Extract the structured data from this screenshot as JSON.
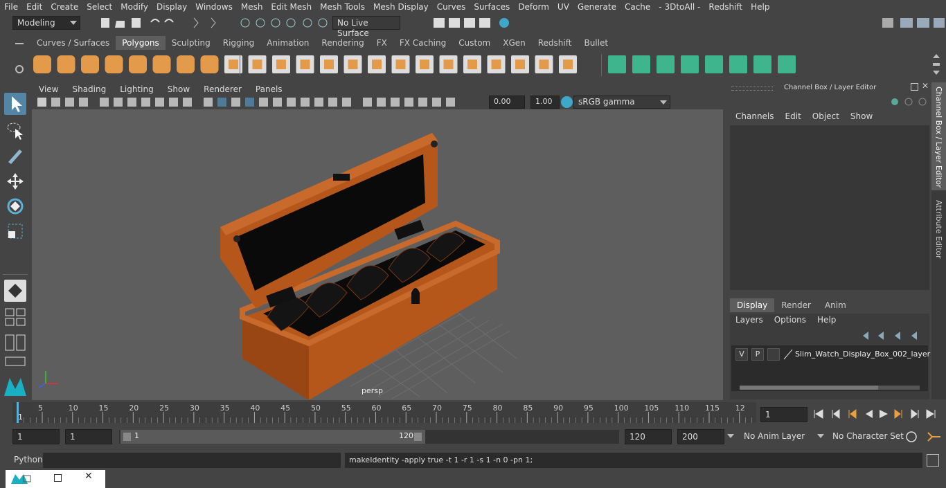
{
  "menubar": {
    "items": [
      "File",
      "Edit",
      "Create",
      "Select",
      "Modify",
      "Display",
      "Windows",
      "Mesh",
      "Edit Mesh",
      "Mesh Tools",
      "Mesh Display",
      "Curves",
      "Surfaces",
      "Deform",
      "UV",
      "Generate",
      "Cache",
      "- 3DtoAll -",
      "Redshift",
      "Help"
    ]
  },
  "statusline": {
    "mode": "Modeling",
    "live_surface": "No Live Surface"
  },
  "shelf": {
    "tabs": [
      "Curves / Surfaces",
      "Polygons",
      "Sculpting",
      "Rigging",
      "Animation",
      "Rendering",
      "FX",
      "FX Caching",
      "Custom",
      "XGen",
      "Redshift",
      "Bullet"
    ],
    "active_tab": "Polygons"
  },
  "panel": {
    "menus": [
      "View",
      "Shading",
      "Lighting",
      "Show",
      "Renderer",
      "Panels"
    ],
    "exposure": "0.00",
    "gamma": "1.00",
    "colorspace": "sRGB gamma",
    "camera_label": "persp"
  },
  "channelbox": {
    "title": "Channel Box / Layer Editor",
    "menus": [
      "Channels",
      "Edit",
      "Object",
      "Show"
    ],
    "layer_tabs": [
      "Display",
      "Render",
      "Anim"
    ],
    "active_layer_tab": "Display",
    "layer_menus": [
      "Layers",
      "Options",
      "Help"
    ],
    "layer": {
      "v": "V",
      "p": "P",
      "name": "Slim_Watch_Display_Box_002_layer"
    },
    "side_tabs": [
      "Channel Box / Layer Editor",
      "Attribute Editor"
    ]
  },
  "timeline": {
    "ticks": [
      "5",
      "10",
      "15",
      "20",
      "25",
      "30",
      "35",
      "40",
      "45",
      "50",
      "55",
      "60",
      "65",
      "70",
      "75",
      "80",
      "85",
      "90",
      "95",
      "100",
      "105",
      "110",
      "115",
      "12"
    ],
    "start_label": "1",
    "current_frame": "1"
  },
  "range": {
    "start": "1",
    "playback_start": "1",
    "slider_start": "1",
    "slider_end": "120",
    "playback_end": "120",
    "end": "200",
    "anim_layer": "No Anim Layer",
    "character_set": "No Character Set"
  },
  "cmdline": {
    "language": "Python",
    "output": "makeIdentity -apply true -t 1 -r 1 -s 1 -n 0 -pn 1;"
  },
  "colors": {
    "wood": "#b5561a",
    "wood_dark": "#7a3510",
    "viewport_bg": "#5e5e5e",
    "shelf_icon": "#e39a4a",
    "shelf_icon_green": "#3fb58e",
    "accent_blue": "#5285a6"
  }
}
